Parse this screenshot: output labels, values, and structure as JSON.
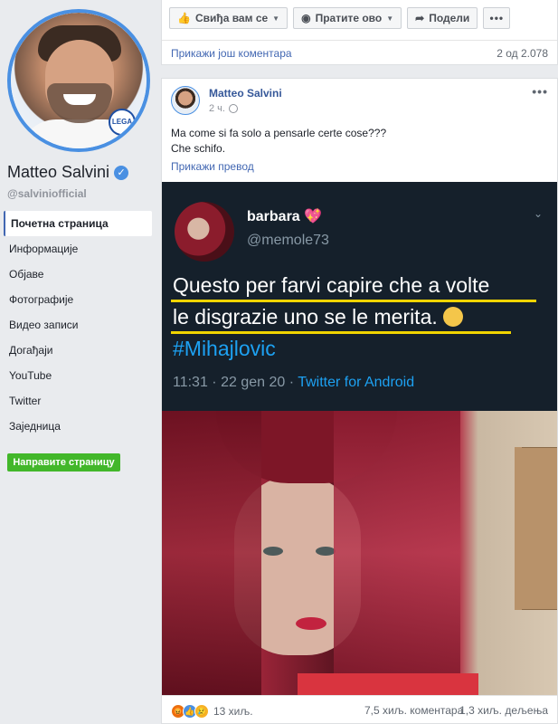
{
  "sidebar": {
    "page_name": "Matteo Salvini",
    "handle": "@salviniofficial",
    "profile_badge_text": "LEGA",
    "nav": [
      {
        "label": "Почетна страница",
        "active": true
      },
      {
        "label": "Информације"
      },
      {
        "label": "Објаве"
      },
      {
        "label": "Фотографије"
      },
      {
        "label": "Видео записи"
      },
      {
        "label": "Догађаји"
      },
      {
        "label": "YouTube"
      },
      {
        "label": "Twitter"
      },
      {
        "label": "Заједница"
      }
    ],
    "create_page_label": "Направите страницу"
  },
  "top_card": {
    "like_label": "Свиђа вам се",
    "follow_label": "Пратите ово",
    "share_label": "Подели",
    "more_label": "•••",
    "more_comments": "Прикажи још коментара",
    "comments_count": "2 од 2.078"
  },
  "post": {
    "author": "Matteo Salvini",
    "time": "2 ч.",
    "options_label": "•••",
    "text_line1": "Ma come si fa solo a pensarle certe cose???",
    "text_line2": "Che schifo.",
    "translate_label": "Прикажи превод",
    "footer": {
      "reactions_count": "13 хиљ.",
      "comments": "7,5 хиљ. коментара",
      "shares": "1,3 хиљ. дељења"
    }
  },
  "tweet": {
    "name": "barbara",
    "heart": "💖",
    "handle": "@memole73",
    "chevron": "⌄",
    "line1": "Questo per farvi capire che a volte",
    "line2": "le disgrazie uno se le merita.",
    "hashtag": "#Mihajlovic",
    "time": "11:31 · 22 gen 20 · ",
    "source": "Twitter for Android"
  },
  "colors": {
    "facebook_blue": "#4267b2",
    "tweet_bg": "#15202b",
    "create_green": "#42b72a",
    "highlight_yellow": "#f0d400"
  },
  "icons": {
    "like": "thumbs-up-icon",
    "follow": "rss-icon",
    "share": "share-arrow-icon",
    "globe": "globe-icon",
    "verified": "verified-badge-icon"
  }
}
